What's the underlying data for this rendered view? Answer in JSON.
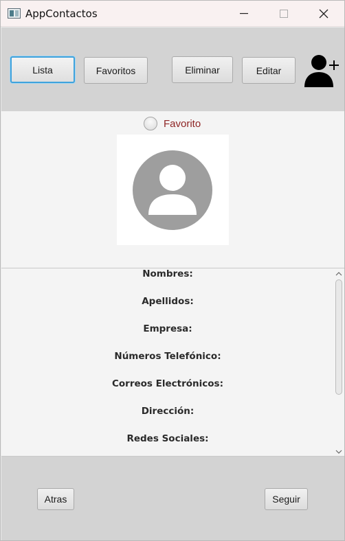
{
  "window": {
    "title": "AppContactos",
    "controls": [
      "minimize-icon",
      "maximize-icon",
      "close-icon"
    ]
  },
  "toolbar": {
    "lista_label": "Lista",
    "favoritos_label": "Favoritos",
    "eliminar_label": "Eliminar",
    "editar_label": "Editar",
    "add_contact_icon": "add-user-icon"
  },
  "profile": {
    "favorite_label": "Favorito",
    "favorite_checked": false,
    "photo_icon": "default-avatar-icon"
  },
  "details": {
    "fields": [
      "Nombres:",
      "Apellidos:",
      "Empresa:",
      "Números Telefónico:",
      "Correos Electrónicos:",
      "Dirección:",
      "Redes Sociales:"
    ]
  },
  "navigation": {
    "back_label": "Atras",
    "next_label": "Seguir"
  },
  "colors": {
    "toolbar_bg": "#d3d3d3",
    "content_bg": "#f4f4f4",
    "focus_accent": "#3fa2dc",
    "favorite_text": "#8e2424",
    "avatar_gray": "#9e9e9e"
  }
}
